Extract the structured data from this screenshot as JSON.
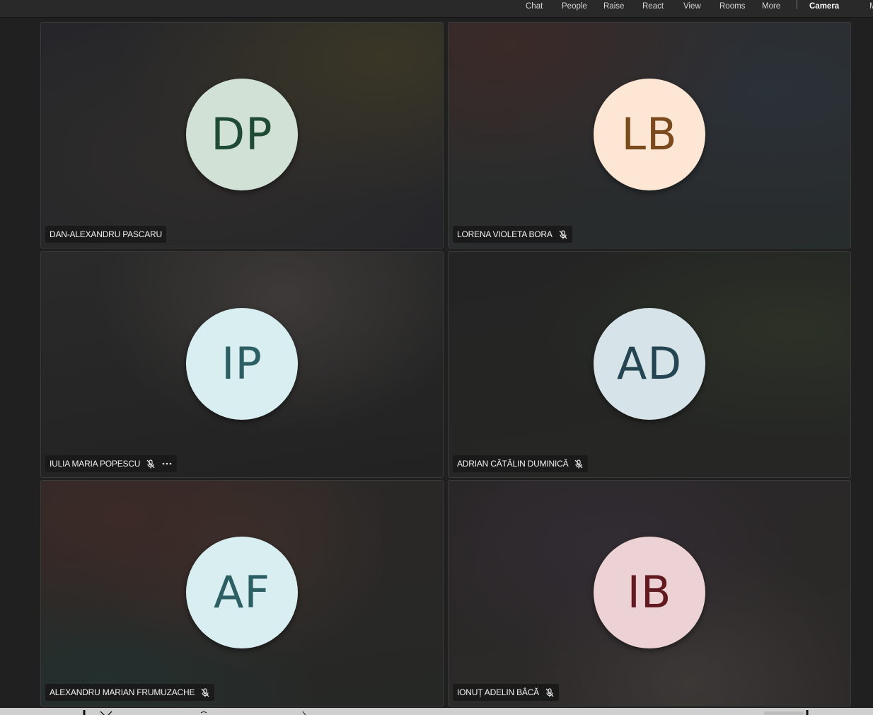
{
  "toolbar": {
    "chat": "Chat",
    "people": "People",
    "raise": "Raise",
    "react": "React",
    "view": "View",
    "rooms": "Rooms",
    "more": "More",
    "camera": "Camera"
  },
  "participants": [
    {
      "name": "DAN-ALEXANDRU PASCARU",
      "initials": "DP",
      "muted": false,
      "avatar_bg": "#d1e1d6",
      "avatar_fg": "#1f4a33"
    },
    {
      "name": "LORENA VIOLETA BORA",
      "initials": "LB",
      "muted": true,
      "avatar_bg": "#fde7d4",
      "avatar_fg": "#7a4a1d"
    },
    {
      "name": "IULIA MARIA POPESCU",
      "initials": "IP",
      "muted": true,
      "avatar_bg": "#d9eef0",
      "avatar_fg": "#2b5f63"
    },
    {
      "name": "ADRIAN CĂTĂLIN DUMINICĂ",
      "initials": "AD",
      "muted": true,
      "avatar_bg": "#d6e3e8",
      "avatar_fg": "#234450"
    },
    {
      "name": "ALEXANDRU MARIAN FRUMUZACHE",
      "initials": "AF",
      "muted": true,
      "avatar_bg": "#d9eef0",
      "avatar_fg": "#2b5f63"
    },
    {
      "name": "IONUȚ ADELIN BÂCĂ",
      "initials": "IB",
      "muted": true,
      "avatar_bg": "#ecd2d4",
      "avatar_fg": "#611a20"
    }
  ],
  "icons": {
    "mic_muted": "mic-off-icon",
    "more_options": "more-horizontal-icon"
  }
}
